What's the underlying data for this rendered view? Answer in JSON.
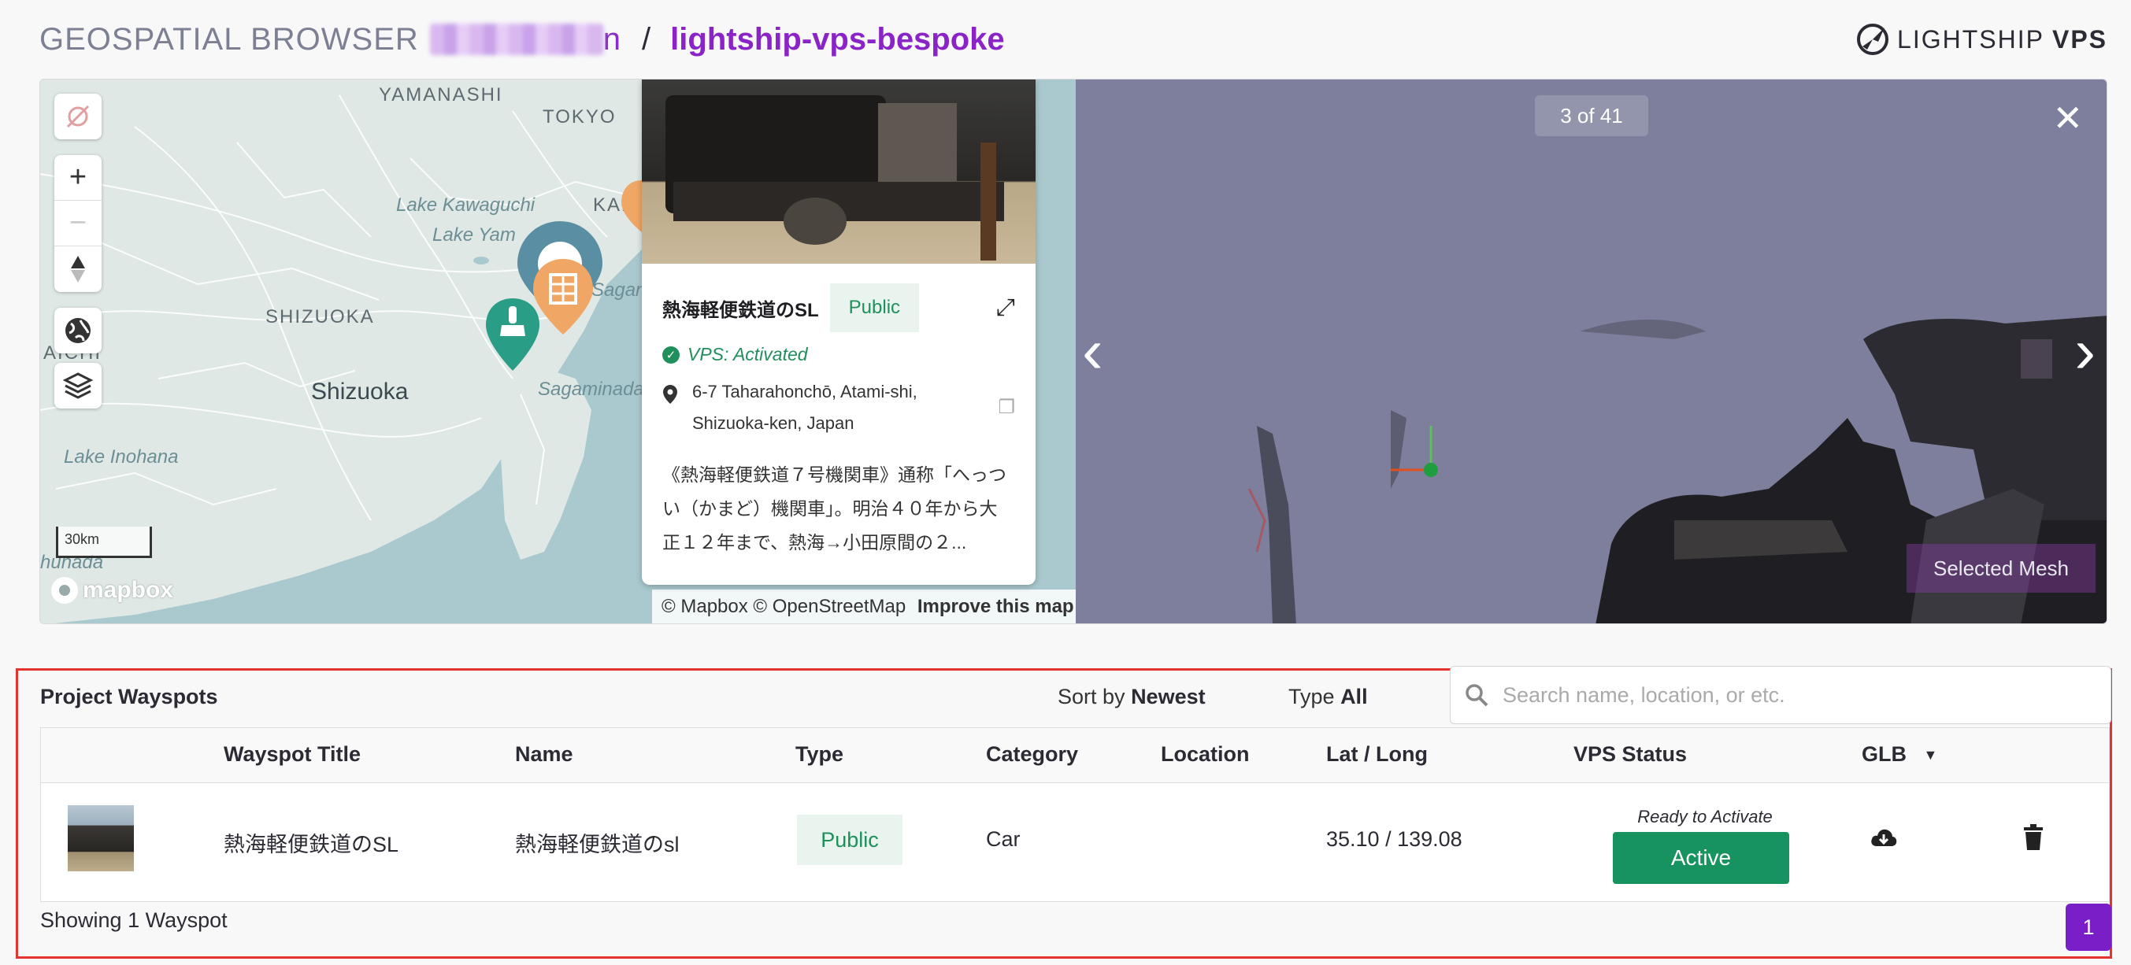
{
  "header": {
    "app_title": "GEOSPATIAL BROWSER",
    "user_tail": "n",
    "separator": "/",
    "project": "lightship-vps-bespoke",
    "brand": "LIGHTSHIP",
    "brand_suffix": "VPS"
  },
  "map": {
    "labels": {
      "yamanashi": "YAMANASHI",
      "tokyo": "TOKYO",
      "kana": "KANA",
      "lake_kawaguchi": "Lake Kawaguchi",
      "lake_yam": "Lake Yam",
      "shizuoka_pref": "SHIZUOKA",
      "aichi": "AICHI",
      "shizuoka_city": "Shizuoka",
      "lake_inohana": "Lake Inohana",
      "hunada": "hunada",
      "sagaminada": "Sagaminada",
      "sagami": "Sagan"
    },
    "scale": "30km",
    "mapbox_logo": "mapbox",
    "attribution": "© Mapbox © OpenStreetMap",
    "improve": "Improve this map"
  },
  "popup": {
    "title": "熱海軽便鉄道のSL",
    "badge": "Public",
    "status": "VPS: Activated",
    "address": "6-7 Taharahonchō, Atami-shi, Shizuoka-ken, Japan",
    "description": "《熱海軽便鉄道７号機関車》通称「へっつい（かまど）機関車」。明治４０年から大正１２年まで、熱海→小田原間の２..."
  },
  "viewer": {
    "counter": "3 of 41",
    "close": "✕",
    "prev": "‹",
    "next": "›",
    "selected_mesh": "Selected Mesh"
  },
  "waypoints": {
    "title": "Project Wayspots",
    "sort_label": "Sort by",
    "sort_value": "Newest",
    "type_label": "Type",
    "type_value": "All",
    "search_placeholder": "Search name, location, or etc.",
    "columns": {
      "title": "Wayspot Title",
      "name": "Name",
      "type": "Type",
      "category": "Category",
      "location": "Location",
      "latlong": "Lat / Long",
      "vps_status": "VPS Status",
      "glb": "GLB"
    },
    "rows": [
      {
        "title": "熱海軽便鉄道のSL",
        "name": "熱海軽便鉄道のsl",
        "type": "Public",
        "category": "Car",
        "location": "",
        "latlong": "35.10 / 139.08",
        "vps_note": "Ready to Activate",
        "vps_button": "Active"
      }
    ],
    "showing": "Showing 1 Wayspot",
    "page": "1"
  },
  "colors": {
    "accent": "#8a24c6",
    "green": "#17935f",
    "highlight_border": "#e3342f"
  }
}
